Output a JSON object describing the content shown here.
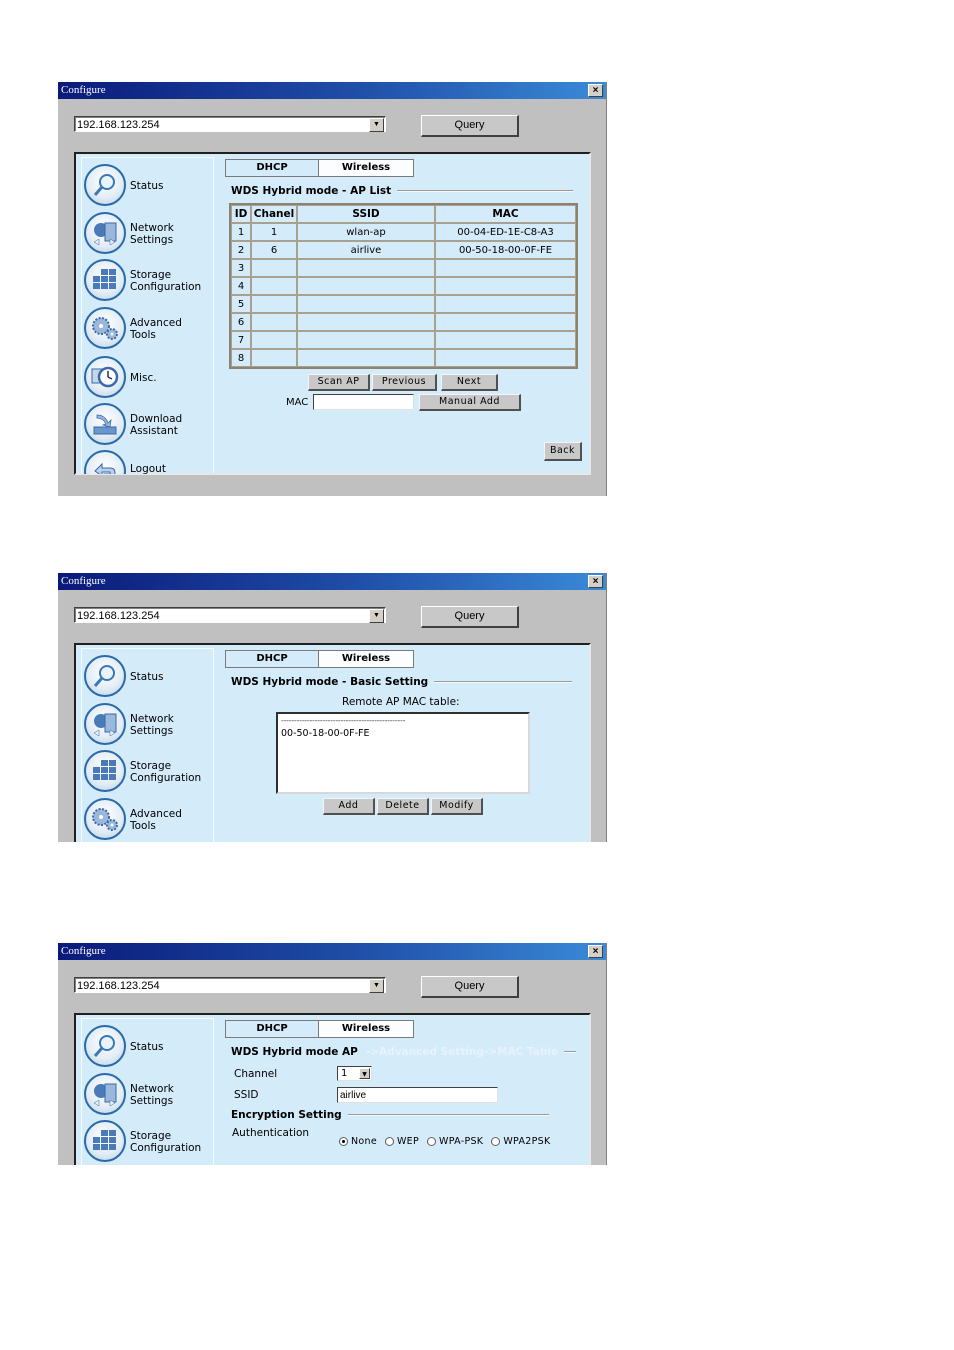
{
  "window_title": "Configure",
  "close_glyph": "✕",
  "address": "192.168.123.254",
  "query_label": "Query",
  "dropdown_glyph": "▼",
  "tabs": [
    {
      "label": "DHCP",
      "active": false
    },
    {
      "label": "Wireless",
      "active": true
    }
  ],
  "sidebar": {
    "items": [
      {
        "label_line1": "Status",
        "label_line2": "",
        "icon": "magnifier-icon"
      },
      {
        "label_line1": "Network",
        "label_line2": "Settings",
        "icon": "network-icon"
      },
      {
        "label_line1": "Storage",
        "label_line2": "Configuration",
        "icon": "storage-grid-icon"
      },
      {
        "label_line1": "Advanced",
        "label_line2": "Tools",
        "icon": "gears-icon"
      },
      {
        "label_line1": "Misc.",
        "label_line2": "",
        "icon": "clock-icon"
      },
      {
        "label_line1": "Download",
        "label_line2": "Assistant",
        "icon": "download-icon"
      },
      {
        "label_line1": "Logout",
        "label_line2": "",
        "icon": "logout-arrow-icon"
      }
    ]
  },
  "screen1": {
    "section_title": "WDS Hybrid mode - AP List",
    "table": {
      "headers": [
        "ID",
        "Chanel",
        "SSID",
        "MAC"
      ],
      "rows": [
        [
          "1",
          "1",
          "wlan-ap",
          "00-04-ED-1E-C8-A3"
        ],
        [
          "2",
          "6",
          "airlive",
          "00-50-18-00-0F-FE"
        ],
        [
          "3",
          "",
          "",
          ""
        ],
        [
          "4",
          "",
          "",
          ""
        ],
        [
          "5",
          "",
          "",
          ""
        ],
        [
          "6",
          "",
          "",
          ""
        ],
        [
          "7",
          "",
          "",
          ""
        ],
        [
          "8",
          "",
          "",
          ""
        ]
      ]
    },
    "scan_ap_label": "Scan AP",
    "previous_label": "Previous",
    "next_label": "Next",
    "mac_label": "MAC",
    "mac_value": "",
    "manual_add_label": "Manual Add",
    "back_label": "Back"
  },
  "screen2": {
    "section_title": "WDS Hybrid mode - Basic Setting",
    "table_label": "Remote AP MAC table:",
    "list_separator": "------------------------------------------------",
    "list_entries": [
      "00-50-18-00-0F-FE"
    ],
    "add_label": "Add",
    "delete_label": "Delete",
    "modify_label": "Modify"
  },
  "screen3": {
    "section_title": "WDS Hybrid mode AP",
    "section_breadcrumb": "->Advanced Setting->MAC Table",
    "channel_label": "Channel",
    "channel_value": "1",
    "ssid_label": "SSID",
    "ssid_value": "airlive",
    "encryption_title": "Encryption Setting",
    "auth_label": "Authentication",
    "auth_options": [
      {
        "label": "None",
        "selected": true
      },
      {
        "label": "WEP",
        "selected": false
      },
      {
        "label": "WPA-PSK",
        "selected": false
      },
      {
        "label": "WPA2PSK",
        "selected": false
      }
    ]
  }
}
